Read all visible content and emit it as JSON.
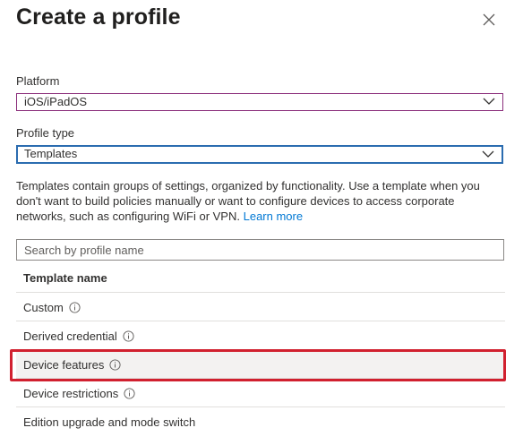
{
  "panel": {
    "title": "Create a profile",
    "close_icon": "close-icon"
  },
  "platform": {
    "label": "Platform",
    "value": "iOS/iPadOS"
  },
  "profile_type": {
    "label": "Profile type",
    "value": "Templates"
  },
  "description": {
    "text": "Templates contain groups of settings, organized by functionality. Use a template when you don't want to build policies manually or want to configure devices to access corporate networks, such as configuring WiFi or VPN.",
    "link": "Learn more"
  },
  "search": {
    "placeholder": "Search by profile name",
    "value": ""
  },
  "table": {
    "header": "Template name",
    "rows": [
      {
        "label": "Custom",
        "info": true
      },
      {
        "label": "Derived credential",
        "info": true
      },
      {
        "label": "Device features",
        "info": true,
        "selected": true
      },
      {
        "label": "Device restrictions",
        "info": true
      },
      {
        "label": "Edition upgrade and mode switch",
        "info": false
      }
    ]
  },
  "colors": {
    "accent": "#0078d4",
    "highlight_border": "#d1202f",
    "platform_border": "#8b2f7b",
    "profile_type_border": "#2b6cb0"
  }
}
